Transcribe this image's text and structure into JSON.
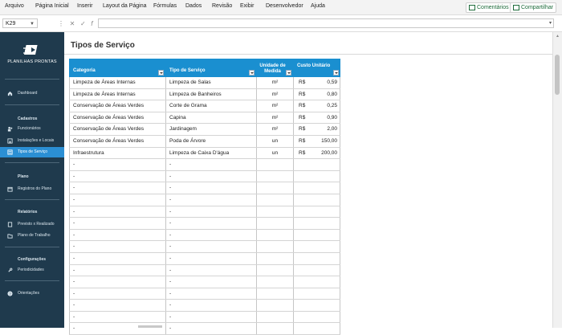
{
  "ribbon": {
    "menu": [
      "Arquivo",
      "Página Inicial",
      "Inserir",
      "Layout da Página",
      "Fórmulas",
      "Dados",
      "Revisão",
      "Exibir",
      "Desenvolvedor",
      "Ajuda"
    ],
    "comments_label": "Comentários",
    "share_label": "Compartilhar"
  },
  "formula_bar": {
    "name_box": "K29",
    "formula": ""
  },
  "sidebar": {
    "logo_text": "PLANILHAS PRONTAS",
    "dashboard": "Dashboard",
    "cadastros_head": "Cadastros",
    "funcionarios": "Funcionários",
    "instalacoes": "Instalações e Locais",
    "tipos": "Tipos de Serviço",
    "plano_head": "Plano",
    "registros": "Registros do Plano",
    "relatorios_head": "Relatórios",
    "previsto": "Previsto x Realizado",
    "plano_trabalho": "Plano de Trabalho",
    "config_head": "Configurações",
    "periodicidades": "Periodicidades",
    "orientacoes": "Orientações"
  },
  "page": {
    "title": "Tipos de Serviço"
  },
  "table": {
    "headers": {
      "categoria": "Categoria",
      "tipo": "Tipo de Serviço",
      "unidade": "Unidade de Medida",
      "custo": "Custo Unitário"
    },
    "currency": "R$",
    "empty_marker": "-",
    "rows": [
      {
        "categoria": "Limpeza de Áreas Internas",
        "tipo": "Limpeza de Salas",
        "unidade": "m²",
        "custo": "0,59"
      },
      {
        "categoria": "Limpeza de Áreas Internas",
        "tipo": "Limpeza de Banheiros",
        "unidade": "m²",
        "custo": "0,80"
      },
      {
        "categoria": "Conservação de Áreas Verdes",
        "tipo": "Corte de Grama",
        "unidade": "m²",
        "custo": "0,25"
      },
      {
        "categoria": "Conservação de Áreas Verdes",
        "tipo": "Capina",
        "unidade": "m²",
        "custo": "0,90"
      },
      {
        "categoria": "Conservação de Áreas Verdes",
        "tipo": "Jardinagem",
        "unidade": "m²",
        "custo": "2,00"
      },
      {
        "categoria": "Conservação de Áreas Verdes",
        "tipo": "Poda de Árvore",
        "unidade": "un",
        "custo": "150,00"
      },
      {
        "categoria": "Infraestrutura",
        "tipo": "Limpeza de Caixa D'água",
        "unidade": "un",
        "custo": "200,00"
      }
    ],
    "empty_row_count": 15
  },
  "colors": {
    "sidebar_bg": "#1f3a4d",
    "accent": "#1a8fd0",
    "active_item": "#2b8fd4",
    "share_green": "#1d6b3a"
  }
}
